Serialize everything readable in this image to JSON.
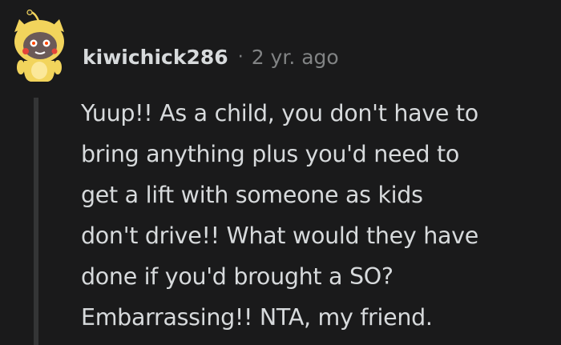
{
  "comment": {
    "username": "kiwichick286",
    "separator": "·",
    "age": "2 yr. ago",
    "body_lines": [
      "Yuup!! As a child, you don't have to",
      "bring anything plus you'd need to",
      "get a lift with someone as kids",
      "don't drive!! What would they have",
      "done if you'd brought a SO?",
      "Embarrassing!! NTA, my friend."
    ]
  },
  "colors": {
    "background": "#1a1a1b",
    "text": "#d7dadc",
    "meta": "#818384",
    "thread_line": "#343536",
    "avatar_costume": "#f2d45c"
  }
}
